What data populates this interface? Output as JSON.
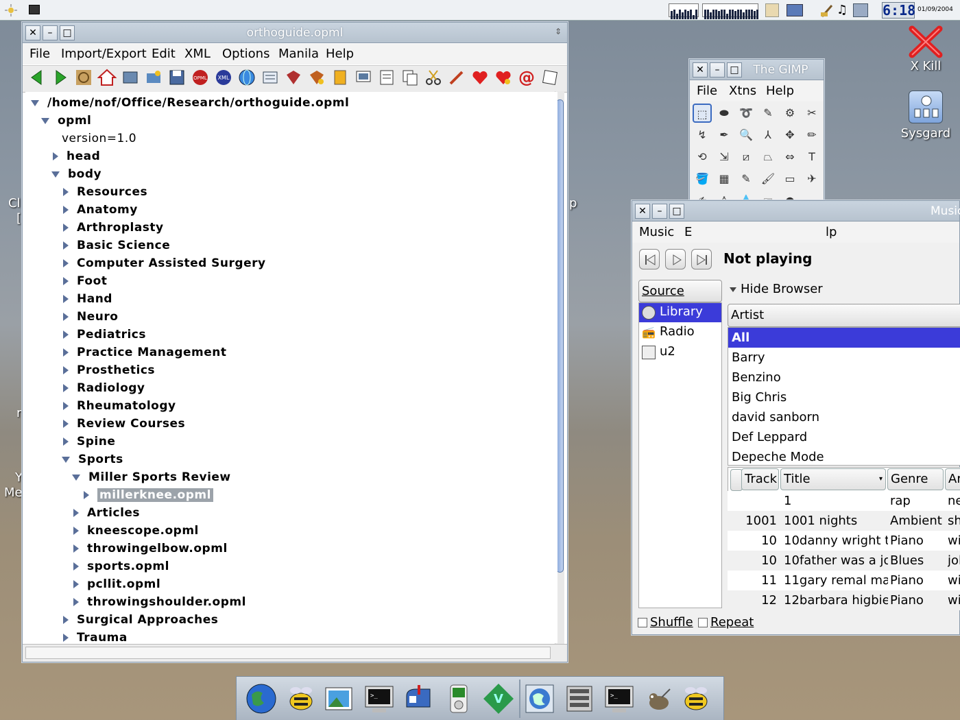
{
  "desktop": {
    "xkill_label": "X Kill",
    "sysgard_label": "Sysgard",
    "edge_fragments": {
      "a": "Cl",
      "b": "[",
      "c": "r",
      "d": "Y",
      "e": "Me",
      "f": "p"
    }
  },
  "top_panel": {
    "clock": "6:18",
    "date": "01/09/2004"
  },
  "orthoguide": {
    "title": "orthoguide.opml",
    "menu": [
      "File",
      "Import/Export",
      "Edit",
      "XML",
      "Options",
      "Manila",
      "Help"
    ],
    "path": "/home/nof/Office/Research/orthoguide.opml",
    "nodes": [
      {
        "label": "opml",
        "depth": 1,
        "state": "open"
      },
      {
        "label": "version=1.0",
        "depth": 2,
        "state": "leaf"
      },
      {
        "label": "head",
        "depth": 2,
        "state": "closed"
      },
      {
        "label": "body",
        "depth": 2,
        "state": "open"
      },
      {
        "label": "Resources",
        "depth": 3,
        "state": "closed"
      },
      {
        "label": "Anatomy",
        "depth": 3,
        "state": "closed"
      },
      {
        "label": "Arthroplasty",
        "depth": 3,
        "state": "closed"
      },
      {
        "label": "Basic Science",
        "depth": 3,
        "state": "closed"
      },
      {
        "label": "Computer Assisted Surgery",
        "depth": 3,
        "state": "closed"
      },
      {
        "label": "Foot",
        "depth": 3,
        "state": "closed"
      },
      {
        "label": "Hand",
        "depth": 3,
        "state": "closed"
      },
      {
        "label": "Neuro",
        "depth": 3,
        "state": "closed"
      },
      {
        "label": "Pediatrics",
        "depth": 3,
        "state": "closed"
      },
      {
        "label": "Practice Management",
        "depth": 3,
        "state": "closed"
      },
      {
        "label": "Prosthetics",
        "depth": 3,
        "state": "closed"
      },
      {
        "label": "Radiology",
        "depth": 3,
        "state": "closed"
      },
      {
        "label": "Rheumatology",
        "depth": 3,
        "state": "closed"
      },
      {
        "label": "Review Courses",
        "depth": 3,
        "state": "closed"
      },
      {
        "label": "Spine",
        "depth": 3,
        "state": "closed"
      },
      {
        "label": "Sports",
        "depth": 3,
        "state": "open"
      },
      {
        "label": "Miller Sports Review",
        "depth": 4,
        "state": "open"
      },
      {
        "label": "millerknee.opml",
        "depth": 5,
        "state": "closed",
        "selected": true
      },
      {
        "label": "Articles",
        "depth": 4,
        "state": "closed"
      },
      {
        "label": "kneescope.opml",
        "depth": 4,
        "state": "closed"
      },
      {
        "label": "throwingelbow.opml",
        "depth": 4,
        "state": "closed"
      },
      {
        "label": "sports.opml",
        "depth": 4,
        "state": "closed"
      },
      {
        "label": "pcllit.opml",
        "depth": 4,
        "state": "closed"
      },
      {
        "label": "throwingshoulder.opml",
        "depth": 4,
        "state": "closed"
      },
      {
        "label": "Surgical Approaches",
        "depth": 3,
        "state": "closed"
      },
      {
        "label": "Trauma",
        "depth": 3,
        "state": "closed"
      }
    ]
  },
  "gimp": {
    "title": "The GIMP",
    "menu": [
      "File",
      "Xtns",
      "Help"
    ],
    "tools": [
      "rect-select",
      "ellipse-select",
      "lasso",
      "fuzzy-select",
      "color-select",
      "scissors",
      "paths",
      "color-picker",
      "magnify",
      "measure",
      "move",
      "crop",
      "transform",
      "scale",
      "shear",
      "perspective",
      "flip",
      "text",
      "bucket-fill",
      "blend",
      "pencil",
      "paintbrush",
      "eraser",
      "airbrush",
      "ink",
      "clone",
      "convolve",
      "smudge",
      "dodge-burn"
    ],
    "tool_glyphs": [
      "⬚",
      "⬬",
      "➰",
      "✎",
      "⚙",
      "✂",
      "↯",
      "✒",
      "🔍",
      "⅄",
      "✥",
      "✏",
      "⟲",
      "⇲",
      "⧄",
      "⏢",
      "⇔",
      "T",
      "🪣",
      "▦",
      "✎",
      "🖌",
      "▭",
      "✈",
      "✍",
      "♙",
      "💧",
      "☞",
      "●"
    ]
  },
  "music": {
    "title": "Music",
    "menu": [
      "Music",
      "E",
      "lp"
    ],
    "status": "Not playing",
    "source_header": "Source",
    "sources": [
      "Library",
      "Radio",
      "u2"
    ],
    "hide_browser": "Hide Browser",
    "artist_header": "Artist",
    "artists": [
      "All",
      "Barry",
      "Benzino",
      "Big Chris",
      "david sanborn",
      "Def Leppard",
      "Depeche Mode"
    ],
    "columns": [
      "Track",
      "Title",
      "Genre",
      "Ar"
    ],
    "tracks": [
      {
        "track": "",
        "title": "1",
        "genre": "rap",
        "artist": "ne"
      },
      {
        "track": "1001",
        "title": "1001 nights",
        "genre": "Ambient",
        "artist": "sh"
      },
      {
        "track": "10",
        "title": "10danny wright  th",
        "genre": "Piano",
        "artist": "wi"
      },
      {
        "track": "10",
        "title": "10father was a joc",
        "genre": "Blues",
        "artist": "jol"
      },
      {
        "track": "11",
        "title": "11gary remal malk",
        "genre": "Piano",
        "artist": "wi"
      },
      {
        "track": "12",
        "title": "12barbara higbie",
        "genre": "Piano",
        "artist": "wi"
      }
    ],
    "shuffle_label": "Shuffle",
    "repeat_label": "Repeat"
  },
  "colors": {
    "selection_blue": "#3b3bd9",
    "tree_triangle": "#5a6f99",
    "window_border": "#8a9aab"
  }
}
